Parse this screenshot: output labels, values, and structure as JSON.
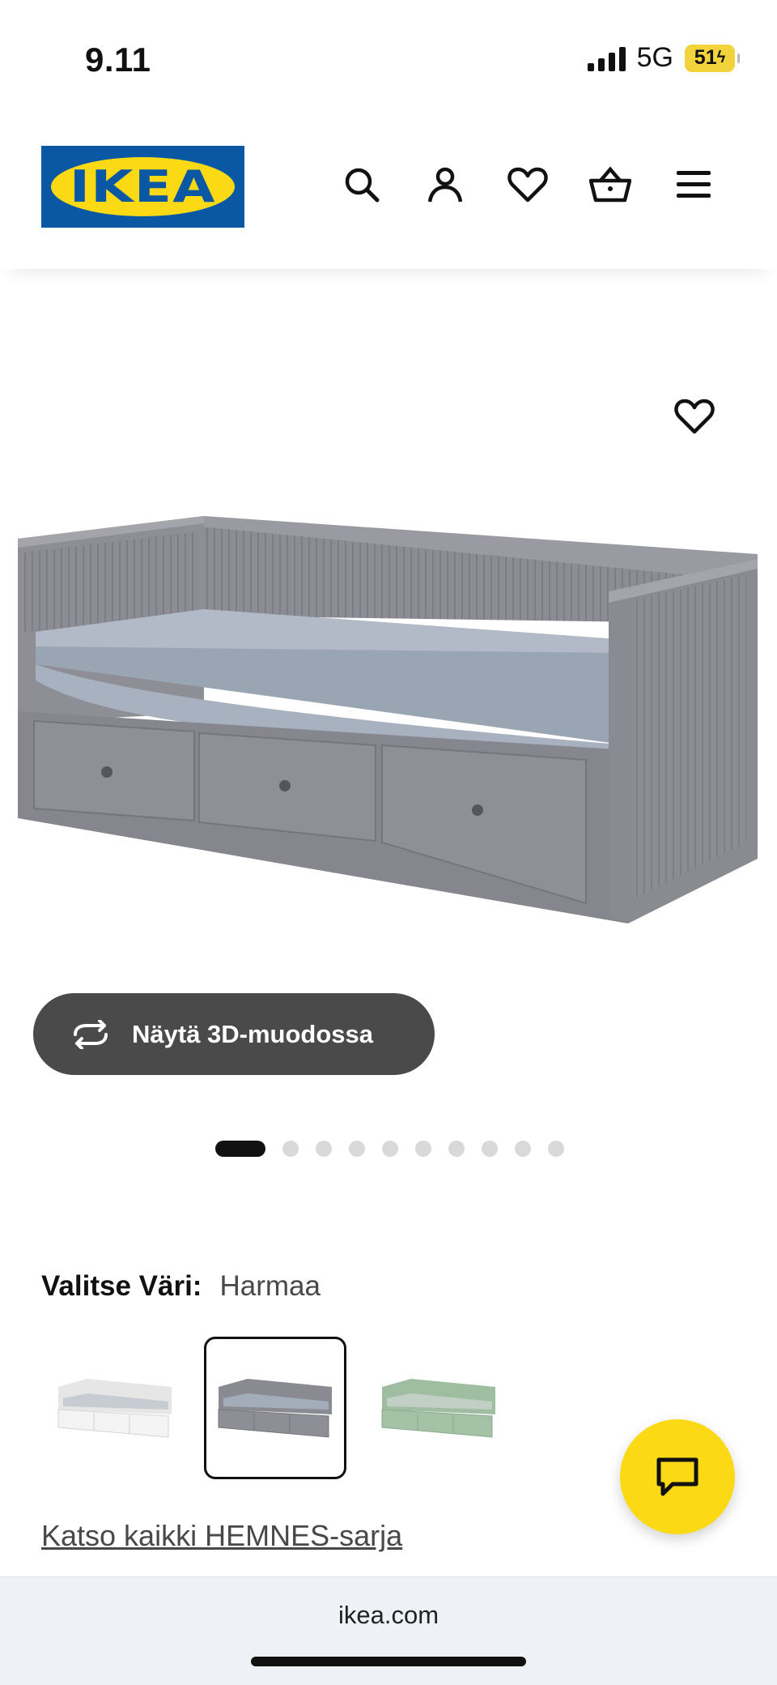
{
  "status_bar": {
    "time": "9.11",
    "network": "5G",
    "battery": "51"
  },
  "header": {
    "logo": "IKEA",
    "icons": [
      "search-icon",
      "account-icon",
      "heart-icon",
      "basket-icon",
      "menu-icon"
    ]
  },
  "product": {
    "view_3d_label": "Näytä 3D-muodossa",
    "gallery": {
      "total": 10,
      "active_index": 0
    }
  },
  "color_selector": {
    "label": "Valitse Väri:",
    "selected": "Harmaa",
    "options": [
      {
        "color": "#f4f4f4",
        "selected": false
      },
      {
        "color": "#8e8e96",
        "selected": true
      },
      {
        "color": "#a4c3a6",
        "selected": false
      }
    ]
  },
  "series_link": "Katso kaikki HEMNES-sarja",
  "browser": {
    "url": "ikea.com"
  },
  "colors": {
    "ikea_blue": "#0a58a3",
    "ikea_yellow": "#fbd914",
    "bed_grey": "#8e8e96"
  }
}
